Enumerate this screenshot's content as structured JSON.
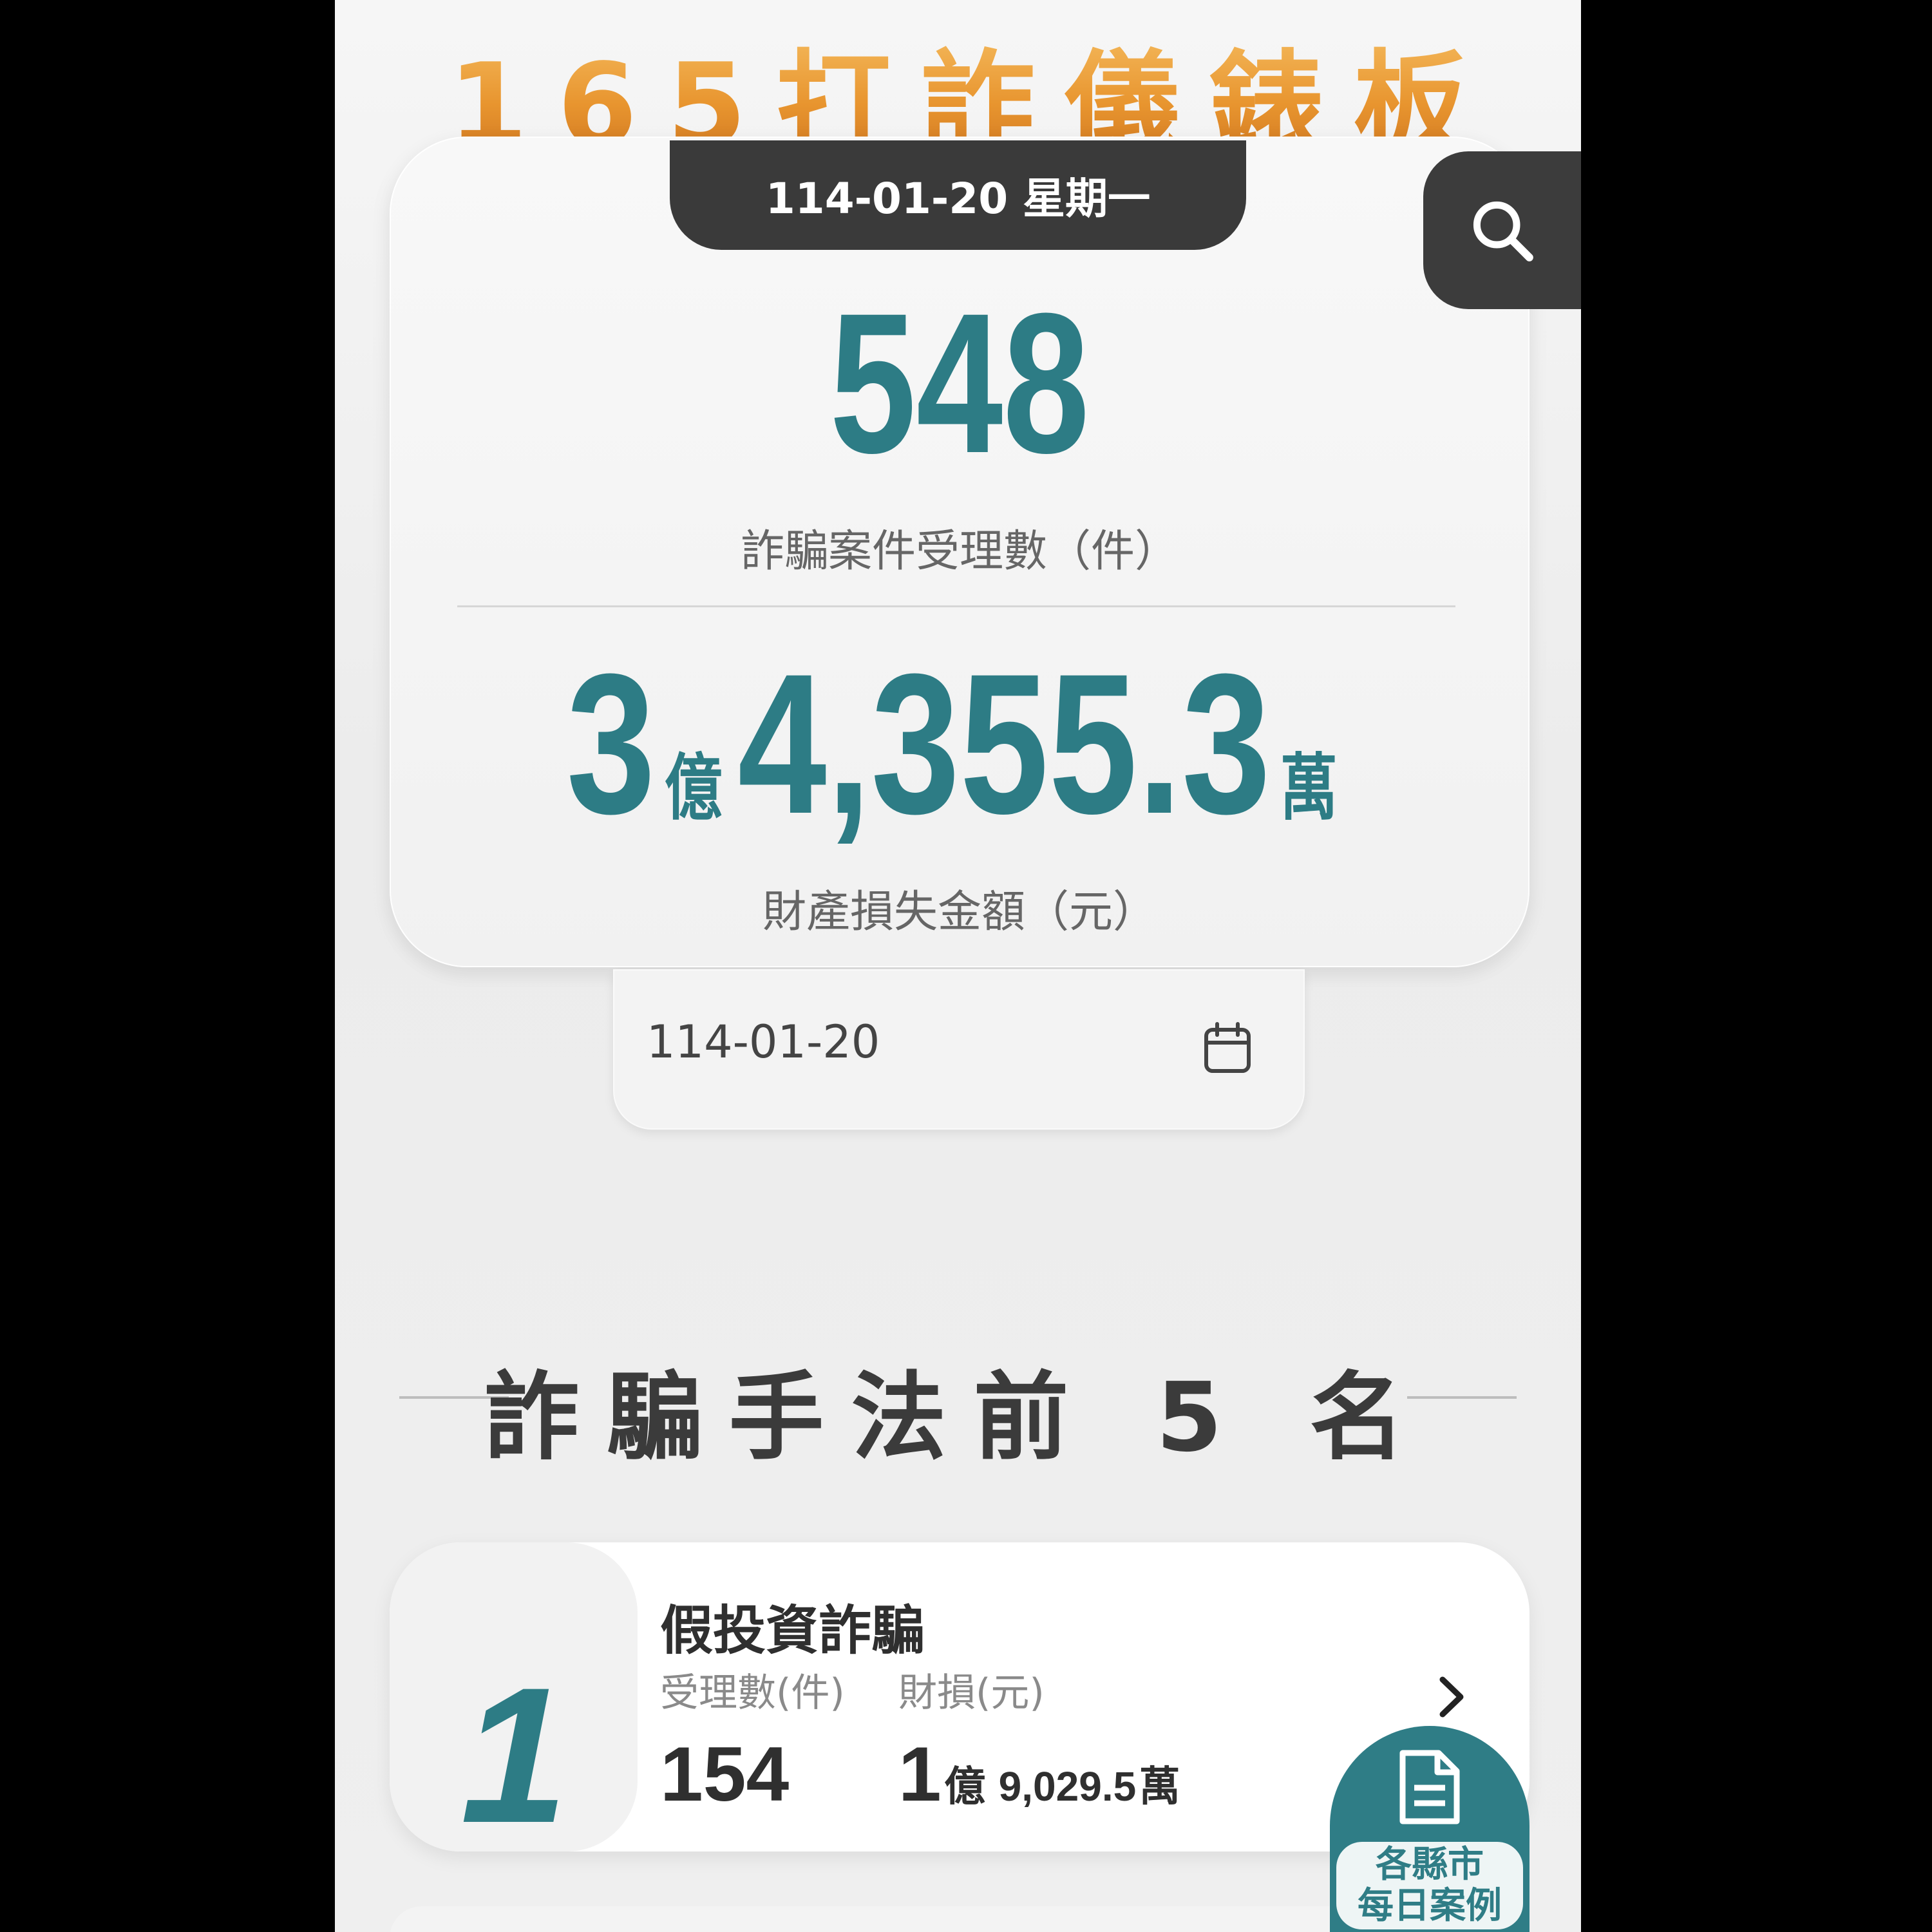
{
  "header": {
    "title": "165打詐儀錶板"
  },
  "summary": {
    "date_with_weekday": "114-01-20 星期一",
    "case_count": "548",
    "case_count_label": "詐騙案件受理數（件）",
    "loss_yi": "3",
    "loss_yi_unit": "億",
    "loss_wan": "4,355.3",
    "loss_wan_unit": "萬",
    "loss_label": "財產損失金額（元）"
  },
  "search": {
    "icon": "search-icon"
  },
  "date_picker": {
    "value": "114-01-20",
    "icon": "calendar-icon"
  },
  "top_methods": {
    "section_title": "詐騙手法前 5 名",
    "items": [
      {
        "rank": "1",
        "name": "假投資詐騙",
        "count_label": "受理數(件)",
        "loss_label": "財損(元)",
        "count": "154",
        "loss_yi": "1",
        "loss_yi_unit": "億",
        "loss_wan": "9,029.5",
        "loss_wan_unit": "萬"
      }
    ]
  },
  "fab": {
    "label_line1": "各縣市",
    "label_line2": "每日案例",
    "icon": "document-icon"
  },
  "colors": {
    "accent": "#2d7c85",
    "title_orange": "#e8952f",
    "dark": "#3a3a3a"
  }
}
